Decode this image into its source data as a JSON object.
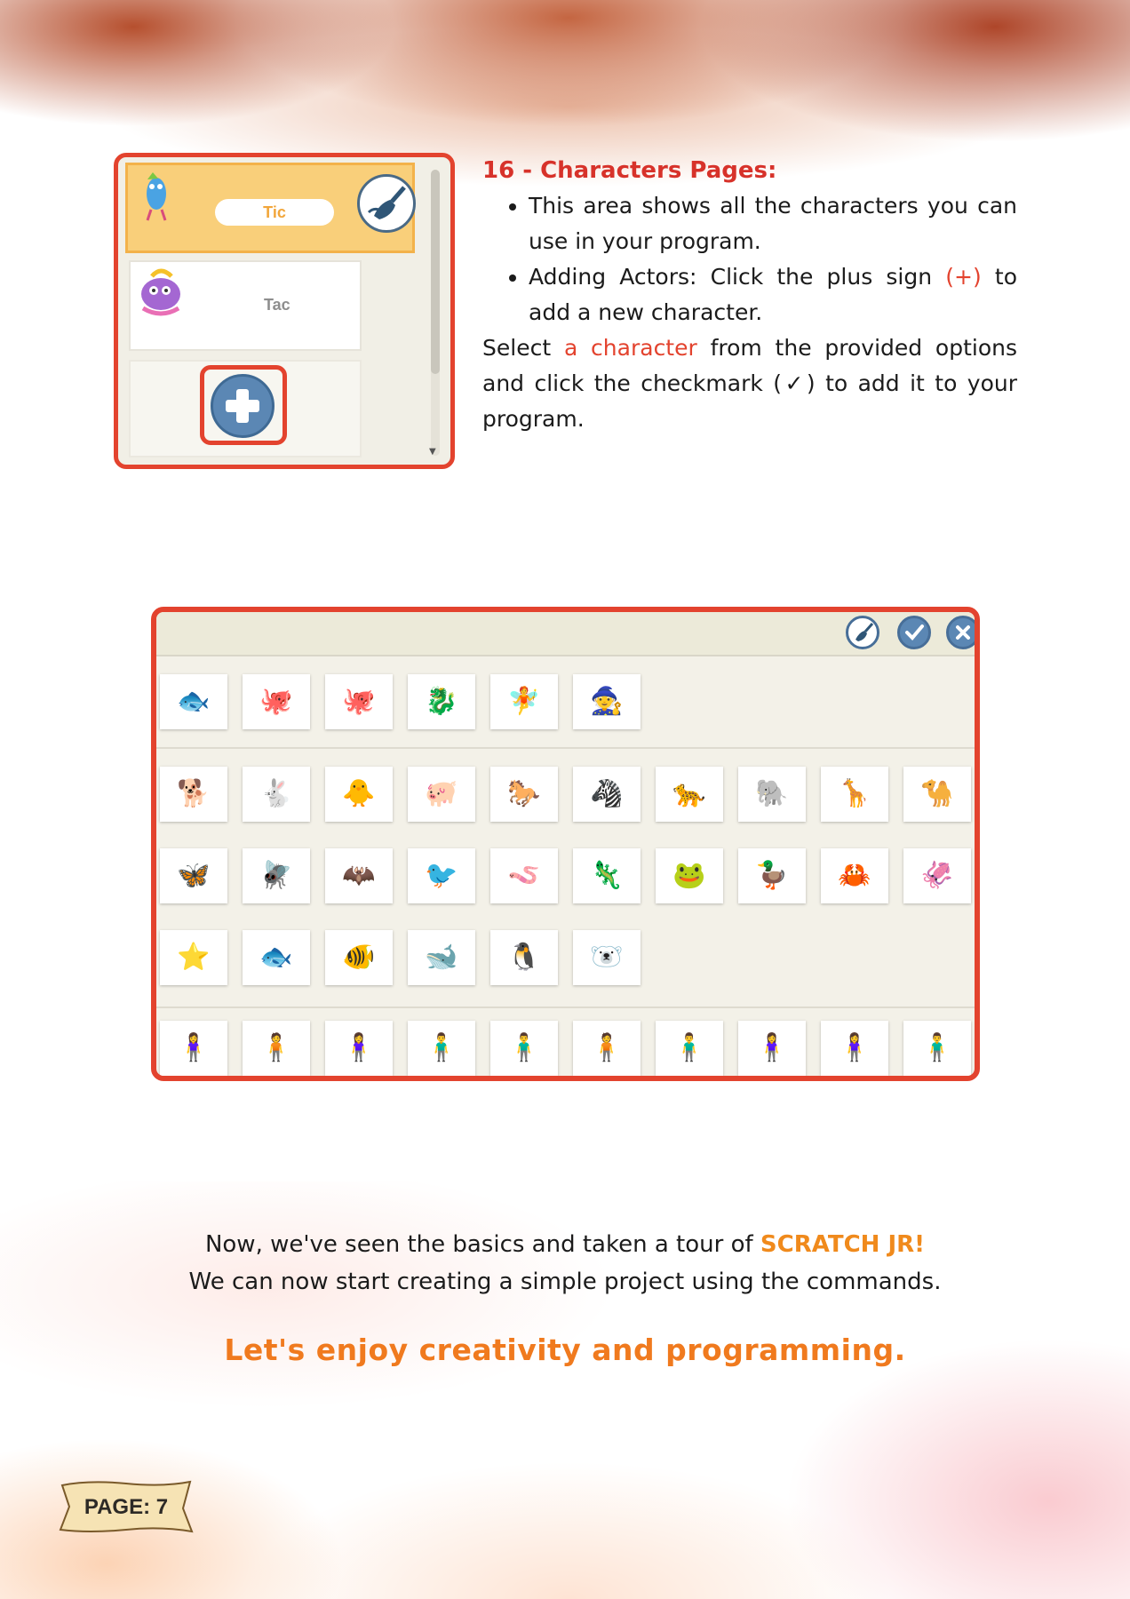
{
  "section16": {
    "heading": "16 - Characters Pages:",
    "bullet1": "This area shows all the characters you can use in your program.",
    "bullet2_before": "Adding Actors: Click the plus sign ",
    "bullet2_plus": "(+)",
    "bullet2_after": " to add a new character.",
    "select_before": "Select ",
    "select_highlight": "a character",
    "select_after": " from the provided options and click the checkmark (✓) to add it to your program."
  },
  "actor_panel": {
    "actor1_name": "Tic",
    "actor2_name": "Tac",
    "plus_icon": "+"
  },
  "library": {
    "row1": [
      "🐟",
      "🐙",
      "🐙",
      "🐉",
      "🧚",
      "🧙"
    ],
    "row2": [
      "🐕",
      "🐇",
      "🐥",
      "🐖",
      "🐎",
      "🦓",
      "🐆",
      "🐘",
      "🦒",
      "🐪"
    ],
    "row3": [
      "🦋",
      "🪰",
      "🦇",
      "🐦",
      "🪱",
      "🦎",
      "🐸",
      "🦆",
      "🦀",
      "🦑"
    ],
    "row4": [
      "⭐",
      "🐟",
      "🐠",
      "🐋",
      "🐧",
      "🐻‍❄️"
    ],
    "row5": [
      "🧍‍♀️",
      "🧍",
      "🧍‍♀️",
      "🧍‍♂️",
      "🧍‍♂️",
      "🧍",
      "🧍‍♂️",
      "🧍‍♀️",
      "🧍‍♀️",
      "🧍‍♂️"
    ]
  },
  "closing": {
    "line1_before": "Now, we've seen the basics and taken a tour of ",
    "line1_brand": "SCRATCH JR!",
    "line2": "We can now start creating a simple project using the commands.",
    "enjoy": "Let's enjoy creativity and programming."
  },
  "page_label": "PAGE: 7",
  "colors": {
    "accent_red": "#e3432e",
    "accent_orange": "#f08a1c",
    "heading_red": "#d7322a"
  }
}
